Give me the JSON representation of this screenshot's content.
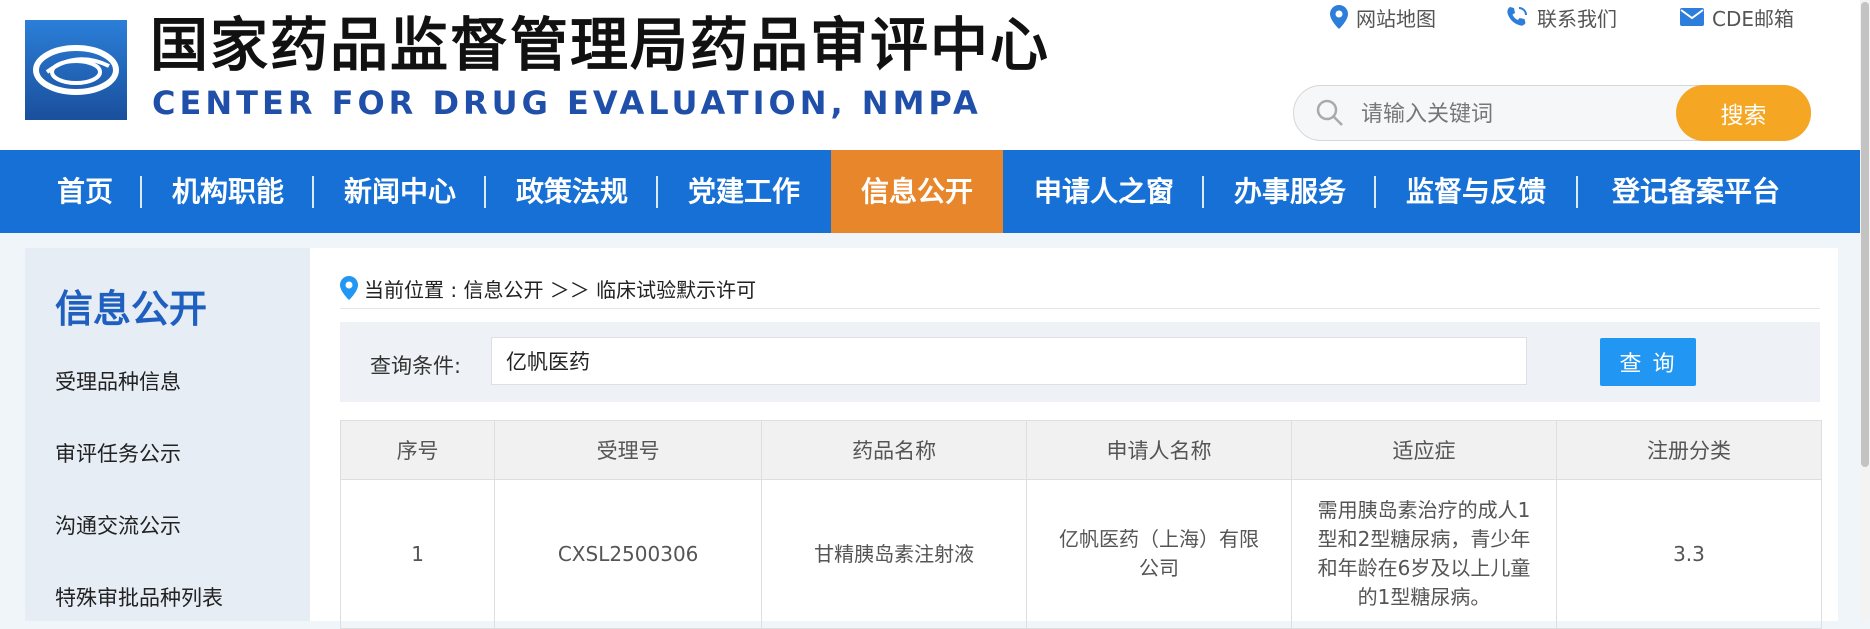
{
  "header": {
    "title_cn": "国家药品监督管理局药品审评中心",
    "title_en": "CENTER FOR DRUG EVALUATION, NMPA",
    "links": [
      {
        "icon": "location-pin-icon",
        "label": "网站地图"
      },
      {
        "icon": "phone-icon",
        "label": "联系我们"
      },
      {
        "icon": "mail-icon",
        "label": "CDE邮箱"
      }
    ],
    "search": {
      "placeholder": "请输入关键词",
      "button": "搜索"
    }
  },
  "nav": {
    "items": [
      "首页",
      "机构职能",
      "新闻中心",
      "政策法规",
      "党建工作",
      "信息公开",
      "申请人之窗",
      "办事服务",
      "监督与反馈",
      "登记备案平台"
    ],
    "active": "信息公开"
  },
  "sidebar": {
    "title": "信息公开",
    "items": [
      "受理品种信息",
      "审评任务公示",
      "沟通交流公示",
      "特殊审批品种列表"
    ]
  },
  "breadcrumb": "当前位置 : 信息公开 ＞＞ 临床试验默示许可",
  "query": {
    "label": "查询条件:",
    "value": "亿帆医药",
    "button": "查 询"
  },
  "table": {
    "headers": [
      "序号",
      "受理号",
      "药品名称",
      "申请人名称",
      "适应症",
      "注册分类"
    ],
    "rows": [
      [
        "1",
        "CXSL2500306",
        "甘精胰岛素注射液",
        "亿帆医药（上海）有限公司",
        "需用胰岛素治疗的成人1型和2型糖尿病，青少年和年龄在6岁及以上儿童的1型糖尿病。",
        "3.3"
      ]
    ]
  },
  "colors": {
    "nav_bg": "#1670d6",
    "nav_active": "#e8862b",
    "search_button": "#f5a623",
    "query_button": "#2196f3",
    "title_en": "#1f4fa8"
  }
}
